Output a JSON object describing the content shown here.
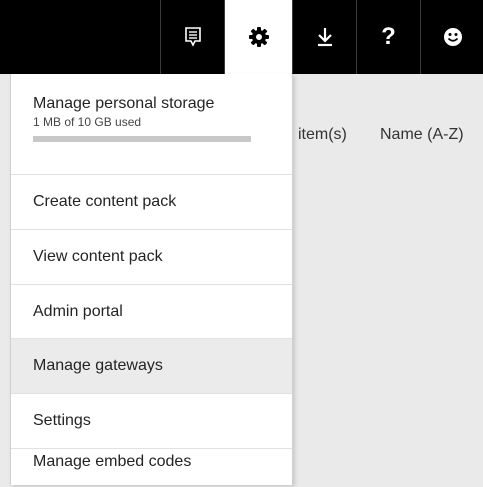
{
  "toolbar": {
    "icons": [
      "feedback-icon",
      "settings-gear-icon",
      "download-icon",
      "help-icon",
      "smiley-icon"
    ],
    "help_glyph": "?"
  },
  "background": {
    "items_label": "item(s)",
    "sort_label": "Name (A-Z)"
  },
  "menu": {
    "storage": {
      "title": "Manage personal storage",
      "usage": "1 MB of 10 GB used",
      "used_fraction": 0.0001
    },
    "items": [
      {
        "label": "Create content pack"
      },
      {
        "label": "View content pack"
      },
      {
        "label": "Admin portal"
      },
      {
        "label": "Manage gateways"
      },
      {
        "label": "Settings"
      },
      {
        "label": "Manage embed codes"
      }
    ]
  }
}
